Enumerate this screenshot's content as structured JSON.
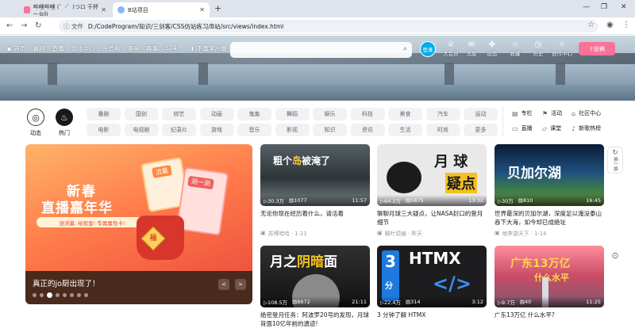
{
  "browser": {
    "tabs": [
      {
        "label": "哔哩哔哩 (゜-゜)つロ 干杯~-bili",
        "active": false
      },
      {
        "label": "B站项目",
        "active": true
      }
    ],
    "new_tab": "+",
    "address": "D:/CodeProgram/知识/三剑客/CSS仿站练习/B站/src/views/index.html",
    "file_label": "文件"
  },
  "header": {
    "nav_items": [
      "首页",
      "番剧",
      "直播",
      "游戏中心",
      "会员购",
      "漫画",
      "赛事",
      "S14",
      "下载客户端"
    ],
    "login_label": "登录",
    "right_items": [
      {
        "icon": "crown-icon",
        "label": "大会员"
      },
      {
        "icon": "message-icon",
        "label": "消息"
      },
      {
        "icon": "wind-icon",
        "label": "动态"
      },
      {
        "icon": "star-icon",
        "label": "收藏"
      },
      {
        "icon": "clock-icon",
        "label": "历史"
      },
      {
        "icon": "bulb-icon",
        "label": "创作中心"
      }
    ],
    "upload_label": "投稿"
  },
  "channels": {
    "left": [
      {
        "icon": "dynamic-icon",
        "label": "动态",
        "color": "#ffffff"
      },
      {
        "icon": "fire-icon",
        "label": "热门",
        "color": "#18191c"
      }
    ],
    "row1": [
      "番剧",
      "国创",
      "综艺",
      "动画",
      "鬼畜",
      "舞蹈",
      "娱乐",
      "科技",
      "美食",
      "汽车",
      "运动"
    ],
    "row2": [
      "电影",
      "电视剧",
      "纪录片",
      "游戏",
      "音乐",
      "影视",
      "知识",
      "资讯",
      "生活",
      "时尚",
      "更多"
    ],
    "side": [
      {
        "icon": "column-icon",
        "label": "专栏"
      },
      {
        "icon": "activity-icon",
        "label": "活动"
      },
      {
        "icon": "community-icon",
        "label": "社区中心"
      },
      {
        "icon": "live-icon",
        "label": "直播"
      },
      {
        "icon": "class-icon",
        "label": "课堂"
      },
      {
        "icon": "song-icon",
        "label": "新歌热榜"
      }
    ]
  },
  "carousel": {
    "title": "真正的jo厨出现了！",
    "art_line1": "新春",
    "art_line2": "直播嘉年华",
    "art_slogan": "送流量, 给现金! 专属属性卡!",
    "art_tag1": "流量",
    "art_tag2": "测一测",
    "art_fu": "福",
    "prev": "<",
    "next": ">",
    "dot_count": 8,
    "active_dot": 3
  },
  "videos": [
    {
      "title": "无论你现在经历着什么，请活着",
      "views": "30.3万",
      "danmaku": "1077",
      "duration": "11:57",
      "uploader": "苏博哈哈 · 1-21",
      "thumb_text": "粗个岛被淹了"
    },
    {
      "title": "聊聊月球三大疑点，让NASA封口的登月细节",
      "views": "64.2万",
      "danmaku": "5875",
      "duration": "13:32",
      "uploader": "枫叶颂遍 · 昨天",
      "thumb_text": "月球 疑点"
    },
    {
      "title": "世界最深的贝加尔湖，深度足以淹没泰山吞下大海，如今却已成绝址",
      "views": "30万",
      "danmaku": "810",
      "duration": "16:45",
      "uploader": "地李游天下 · 1-14",
      "thumb_text": "贝加尔湖"
    },
    {
      "title": "绝密登月任务：阿波罗20号的发现，月球背面10亿年前的遗迹!",
      "views": "108.5万",
      "danmaku": "8672",
      "duration": "21:11",
      "uploader": "",
      "thumb_text": "月之阴暗面"
    },
    {
      "title": "3 分钟了解 HTMX",
      "views": "22.4万",
      "danmaku": "314",
      "duration": "3:12",
      "uploader": "",
      "thumb_text": "HTMX"
    },
    {
      "title": "广东13万亿 什么水平?",
      "views": "9.7万",
      "danmaku": "40",
      "duration": "11:25",
      "uploader": "",
      "thumb_text": "广东13万亿"
    }
  ],
  "float": {
    "refresh_label": "换一换",
    "top_icon": "back-top-icon"
  }
}
